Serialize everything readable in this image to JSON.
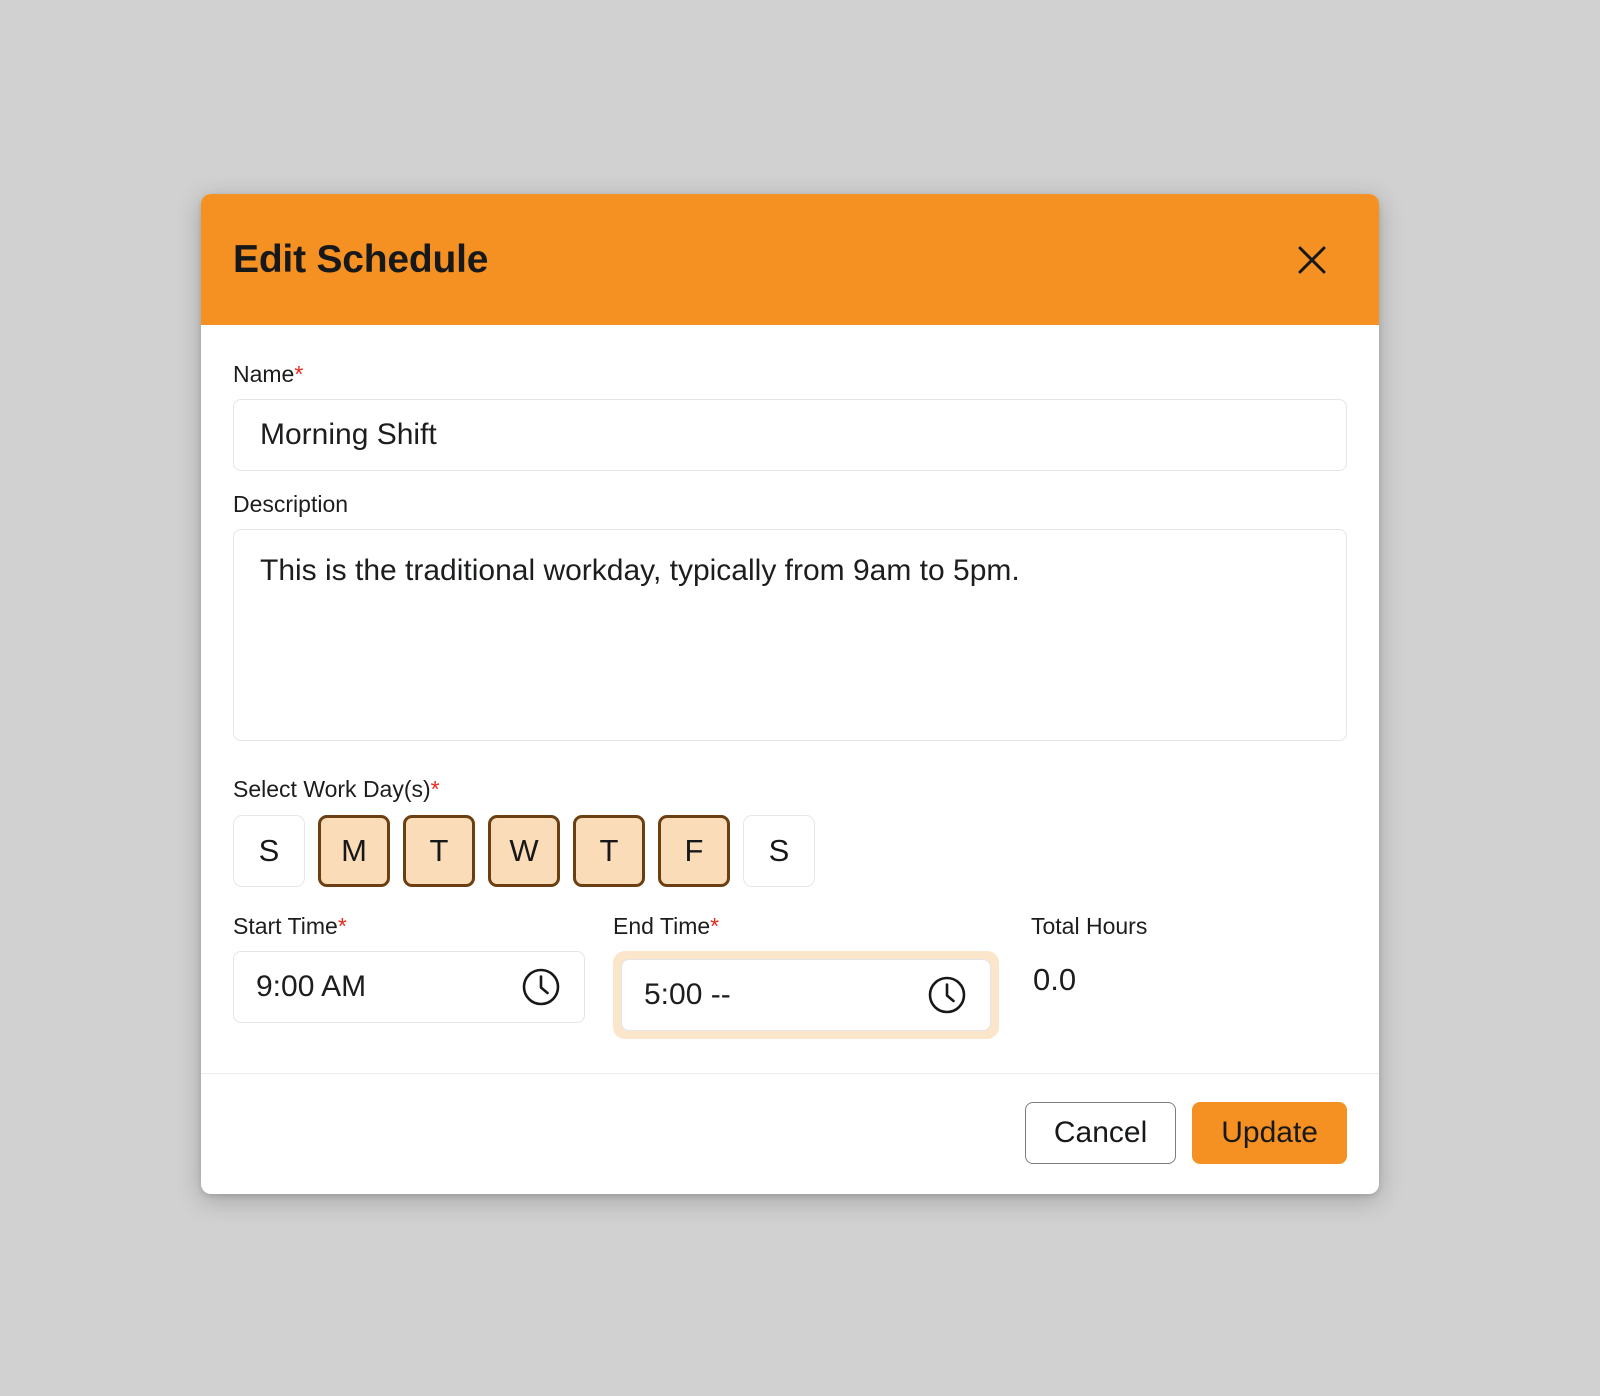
{
  "page": {
    "background_color": "#d1d1d1"
  },
  "colors": {
    "accent": "#f59122",
    "chip_selected_bg": "#fadcb8",
    "chip_selected_border": "#6b3f12",
    "required_asterisk": "#e8281d",
    "focus_ring": "#fbe5cb"
  },
  "dialog": {
    "title": "Edit Schedule",
    "close_icon": "close-icon"
  },
  "form": {
    "name": {
      "label": "Name",
      "required_mark": "*",
      "value": "Morning Shift",
      "placeholder": "Enter schedule name"
    },
    "description": {
      "label": "Description",
      "value": "This is the traditional workday, typically from 9am to 5pm.",
      "placeholder": "Enter description"
    },
    "work_days": {
      "label": "Select Work Day(s)",
      "required_mark": "*",
      "days": [
        {
          "label": "S",
          "name": "day-chip-sunday",
          "selected": false
        },
        {
          "label": "M",
          "name": "day-chip-monday",
          "selected": true
        },
        {
          "label": "T",
          "name": "day-chip-tuesday",
          "selected": true
        },
        {
          "label": "W",
          "name": "day-chip-wednesday",
          "selected": true
        },
        {
          "label": "T",
          "name": "day-chip-thursday",
          "selected": true
        },
        {
          "label": "F",
          "name": "day-chip-friday",
          "selected": true
        },
        {
          "label": "S",
          "name": "day-chip-saturday",
          "selected": false
        }
      ]
    },
    "start_time": {
      "label": "Start Time",
      "required_mark": "*",
      "value": "9:00 AM",
      "icon": "clock-icon",
      "focused": false
    },
    "end_time": {
      "label": "End Time",
      "required_mark": "*",
      "value": "5:00 --",
      "icon": "clock-icon",
      "focused": true
    },
    "total_hours": {
      "label": "Total Hours",
      "value": "0.0"
    }
  },
  "footer": {
    "cancel_label": "Cancel",
    "update_label": "Update"
  }
}
